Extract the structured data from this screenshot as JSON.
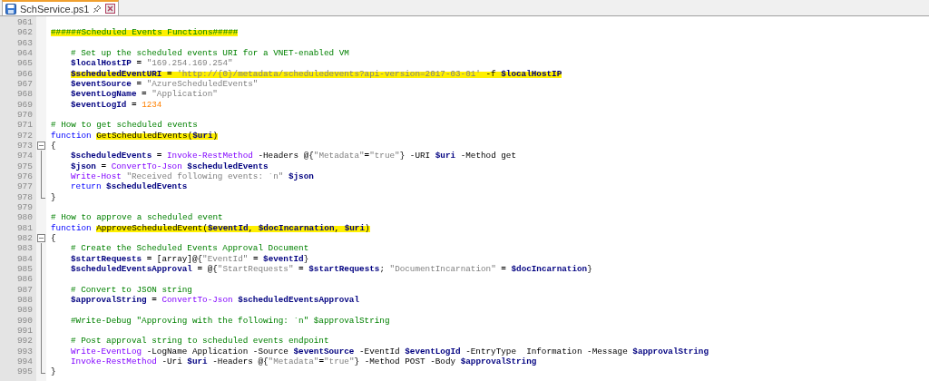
{
  "tab": {
    "title": "SchService.ps1",
    "selected": true
  },
  "lines": [
    {
      "number": "961",
      "kind": "code"
    },
    {
      "number": "962",
      "kind": "code",
      "indented": false,
      "tokens": [
        {
          "kind": "comment",
          "text": "######Scheduled Events Functions#####",
          "highlighted": true
        }
      ]
    },
    {
      "number": "963",
      "kind": "code"
    },
    {
      "number": "964",
      "kind": "code",
      "indented": true,
      "tokens": [
        {
          "kind": "comment",
          "text": "# Set up the scheduled events URI for a VNET-enabled VM",
          "highlighted": false
        }
      ]
    },
    {
      "number": "965",
      "kind": "code",
      "indented": true,
      "tokens": [
        {
          "kind": "variable",
          "text": "$localHostIP",
          "highlighted": false
        },
        {
          "kind": "operator",
          "text": " = ",
          "highlighted": false
        },
        {
          "kind": "string",
          "text": "\"169.254.169.254\"",
          "highlighted": false
        }
      ]
    },
    {
      "number": "966",
      "kind": "code",
      "indented": true,
      "tokens": [
        {
          "kind": "variable",
          "text": "$scheduledEventURI",
          "highlighted": true
        },
        {
          "kind": "operator",
          "text": " = ",
          "highlighted": true
        },
        {
          "kind": "string",
          "text": "'http://{0}/metadata/scheduledevents?api-version=2017-03-01'",
          "highlighted": true
        },
        {
          "kind": "plain",
          "text": " -f ",
          "highlighted": true
        },
        {
          "kind": "variable",
          "text": "$localHostIP",
          "highlighted": true
        }
      ]
    },
    {
      "number": "967",
      "kind": "code",
      "indented": true,
      "tokens": [
        {
          "kind": "variable",
          "text": "$eventSource",
          "highlighted": false
        },
        {
          "kind": "operator",
          "text": " = ",
          "highlighted": false
        },
        {
          "kind": "string",
          "text": "\"AzureScheduledEvents\"",
          "highlighted": false
        }
      ]
    },
    {
      "number": "968",
      "kind": "code",
      "indented": true,
      "tokens": [
        {
          "kind": "variable",
          "text": "$eventLogName",
          "highlighted": false
        },
        {
          "kind": "operator",
          "text": " = ",
          "highlighted": false
        },
        {
          "kind": "string",
          "text": "\"Application\"",
          "highlighted": false
        }
      ]
    },
    {
      "number": "969",
      "kind": "code",
      "indented": true,
      "tokens": [
        {
          "kind": "variable",
          "text": "$eventLogId",
          "highlighted": false
        },
        {
          "kind": "operator",
          "text": " = ",
          "highlighted": false
        },
        {
          "kind": "number",
          "text": "1234",
          "highlighted": false
        }
      ]
    },
    {
      "number": "970",
      "kind": "code"
    },
    {
      "number": "971",
      "kind": "code",
      "indented": false,
      "tokens": [
        {
          "kind": "comment",
          "text": "# How to get scheduled events",
          "highlighted": false
        }
      ]
    },
    {
      "number": "972",
      "kind": "code",
      "indented": false,
      "tokens": [
        {
          "kind": "keyword",
          "text": "function ",
          "highlighted": false
        },
        {
          "kind": "plain",
          "text": "GetScheduledEvents(",
          "highlighted": true
        },
        {
          "kind": "variable",
          "text": "$uri",
          "highlighted": true
        },
        {
          "kind": "plain",
          "text": ")",
          "highlighted": true
        }
      ]
    },
    {
      "number": "973",
      "kind": "fold_start",
      "indented": false,
      "tokens": [
        {
          "kind": "plain",
          "text": "{",
          "highlighted": false
        }
      ]
    },
    {
      "number": "974",
      "kind": "fold_body",
      "indented": true,
      "tokens": [
        {
          "kind": "variable",
          "text": "$scheduledEvents",
          "highlighted": false
        },
        {
          "kind": "operator",
          "text": " = ",
          "highlighted": false
        },
        {
          "kind": "cmdlet",
          "text": "Invoke-RestMethod",
          "highlighted": false
        },
        {
          "kind": "plain",
          "text": " -Headers @{",
          "highlighted": false
        },
        {
          "kind": "string",
          "text": "\"Metadata\"",
          "highlighted": false
        },
        {
          "kind": "operator",
          "text": "=",
          "highlighted": false
        },
        {
          "kind": "string",
          "text": "\"true\"",
          "highlighted": false
        },
        {
          "kind": "plain",
          "text": "} -URI ",
          "highlighted": false
        },
        {
          "kind": "variable",
          "text": "$uri",
          "highlighted": false
        },
        {
          "kind": "plain",
          "text": " -Method get",
          "highlighted": false
        }
      ]
    },
    {
      "number": "975",
      "kind": "fold_body",
      "indented": true,
      "tokens": [
        {
          "kind": "variable",
          "text": "$json",
          "highlighted": false
        },
        {
          "kind": "operator",
          "text": " = ",
          "highlighted": false
        },
        {
          "kind": "cmdlet",
          "text": "ConvertTo-Json ",
          "highlighted": false
        },
        {
          "kind": "variable",
          "text": "$scheduledEvents",
          "highlighted": false
        }
      ]
    },
    {
      "number": "976",
      "kind": "fold_body",
      "indented": true,
      "tokens": [
        {
          "kind": "cmdlet",
          "text": "Write-Host ",
          "highlighted": false
        },
        {
          "kind": "string",
          "text": "\"Received following events: `n\" ",
          "highlighted": false
        },
        {
          "kind": "variable",
          "text": "$json",
          "highlighted": false
        }
      ]
    },
    {
      "number": "977",
      "kind": "fold_body",
      "indented": true,
      "tokens": [
        {
          "kind": "keyword",
          "text": "return ",
          "highlighted": false
        },
        {
          "kind": "variable",
          "text": "$scheduledEvents",
          "highlighted": false
        }
      ]
    },
    {
      "number": "978",
      "kind": "fold_end",
      "indented": false,
      "tokens": [
        {
          "kind": "plain",
          "text": "}",
          "highlighted": false
        }
      ]
    },
    {
      "number": "979",
      "kind": "code"
    },
    {
      "number": "980",
      "kind": "code",
      "indented": false,
      "tokens": [
        {
          "kind": "comment",
          "text": "# How to approve a scheduled event",
          "highlighted": false
        }
      ]
    },
    {
      "number": "981",
      "kind": "code",
      "indented": false,
      "tokens": [
        {
          "kind": "keyword",
          "text": "function ",
          "highlighted": false
        },
        {
          "kind": "plain",
          "text": "ApproveScheduledEvent(",
          "highlighted": true
        },
        {
          "kind": "variable",
          "text": "$eventId",
          "highlighted": true
        },
        {
          "kind": "plain",
          "text": ", ",
          "highlighted": true
        },
        {
          "kind": "variable",
          "text": "$docIncarnation",
          "highlighted": true
        },
        {
          "kind": "plain",
          "text": ", ",
          "highlighted": true
        },
        {
          "kind": "variable",
          "text": "$uri",
          "highlighted": true
        },
        {
          "kind": "plain",
          "text": ")",
          "highlighted": true
        }
      ]
    },
    {
      "number": "982",
      "kind": "fold_start",
      "indented": false,
      "tokens": [
        {
          "kind": "plain",
          "text": "{",
          "highlighted": false
        }
      ]
    },
    {
      "number": "983",
      "kind": "fold_body",
      "indented": true,
      "tokens": [
        {
          "kind": "comment",
          "text": "# Create the Scheduled Events Approval Document",
          "highlighted": false
        }
      ]
    },
    {
      "number": "984",
      "kind": "fold_body",
      "indented": true,
      "tokens": [
        {
          "kind": "variable",
          "text": "$startRequests",
          "highlighted": false
        },
        {
          "kind": "operator",
          "text": " = ",
          "highlighted": false
        },
        {
          "kind": "plain",
          "text": "[array]@{",
          "highlighted": false
        },
        {
          "kind": "string",
          "text": "\"EventId\"",
          "highlighted": false
        },
        {
          "kind": "operator",
          "text": " = ",
          "highlighted": false
        },
        {
          "kind": "variable",
          "text": "$eventId",
          "highlighted": false
        },
        {
          "kind": "plain",
          "text": "}",
          "highlighted": false
        }
      ]
    },
    {
      "number": "985",
      "kind": "fold_body",
      "indented": true,
      "tokens": [
        {
          "kind": "variable",
          "text": "$scheduledEventsApproval",
          "highlighted": false
        },
        {
          "kind": "operator",
          "text": " = ",
          "highlighted": false
        },
        {
          "kind": "plain",
          "text": "@{",
          "highlighted": false
        },
        {
          "kind": "string",
          "text": "\"StartRequests\"",
          "highlighted": false
        },
        {
          "kind": "operator",
          "text": " = ",
          "highlighted": false
        },
        {
          "kind": "variable",
          "text": "$startRequests",
          "highlighted": false
        },
        {
          "kind": "plain",
          "text": "; ",
          "highlighted": false
        },
        {
          "kind": "string",
          "text": "\"DocumentIncarnation\"",
          "highlighted": false
        },
        {
          "kind": "operator",
          "text": " = ",
          "highlighted": false
        },
        {
          "kind": "variable",
          "text": "$docIncarnation",
          "highlighted": false
        },
        {
          "kind": "plain",
          "text": "}",
          "highlighted": false
        }
      ]
    },
    {
      "number": "986",
      "kind": "fold_body"
    },
    {
      "number": "987",
      "kind": "fold_body",
      "indented": true,
      "tokens": [
        {
          "kind": "comment",
          "text": "# Convert to JSON string",
          "highlighted": false
        }
      ]
    },
    {
      "number": "988",
      "kind": "fold_body",
      "indented": true,
      "tokens": [
        {
          "kind": "variable",
          "text": "$approvalString",
          "highlighted": false
        },
        {
          "kind": "operator",
          "text": " = ",
          "highlighted": false
        },
        {
          "kind": "cmdlet",
          "text": "ConvertTo-Json ",
          "highlighted": false
        },
        {
          "kind": "variable",
          "text": "$scheduledEventsApproval",
          "highlighted": false
        }
      ]
    },
    {
      "number": "989",
      "kind": "fold_body"
    },
    {
      "number": "990",
      "kind": "fold_body",
      "indented": true,
      "tokens": [
        {
          "kind": "comment",
          "text": "#Write-Debug \"Approving with the following: `n\" $approvalString",
          "highlighted": false
        }
      ]
    },
    {
      "number": "991",
      "kind": "fold_body"
    },
    {
      "number": "992",
      "kind": "fold_body",
      "indented": true,
      "tokens": [
        {
          "kind": "comment",
          "text": "# Post approval string to scheduled events endpoint",
          "highlighted": false
        }
      ]
    },
    {
      "number": "993",
      "kind": "fold_body",
      "indented": true,
      "tokens": [
        {
          "kind": "cmdlet",
          "text": "Write-EventLog",
          "highlighted": false
        },
        {
          "kind": "plain",
          "text": " -LogName Application -Source ",
          "highlighted": false
        },
        {
          "kind": "variable",
          "text": "$eventSource",
          "highlighted": false
        },
        {
          "kind": "plain",
          "text": " -EventId ",
          "highlighted": false
        },
        {
          "kind": "variable",
          "text": "$eventLogId",
          "highlighted": false
        },
        {
          "kind": "plain",
          "text": " -EntryType  Information -Message ",
          "highlighted": false
        },
        {
          "kind": "variable",
          "text": "$approvalString",
          "highlighted": false
        }
      ]
    },
    {
      "number": "994",
      "kind": "fold_body",
      "indented": true,
      "tokens": [
        {
          "kind": "cmdlet",
          "text": "Invoke-RestMethod",
          "highlighted": false
        },
        {
          "kind": "plain",
          "text": " -Uri ",
          "highlighted": false
        },
        {
          "kind": "variable",
          "text": "$uri",
          "highlighted": false
        },
        {
          "kind": "plain",
          "text": " -Headers @{",
          "highlighted": false
        },
        {
          "kind": "string",
          "text": "\"Metadata\"",
          "highlighted": false
        },
        {
          "kind": "operator",
          "text": "=",
          "highlighted": false
        },
        {
          "kind": "string",
          "text": "\"true\"",
          "highlighted": false
        },
        {
          "kind": "plain",
          "text": "} -Method POST -Body ",
          "highlighted": false
        },
        {
          "kind": "variable",
          "text": "$approvalString",
          "highlighted": false
        }
      ]
    },
    {
      "number": "995",
      "kind": "fold_end",
      "indented": false,
      "tokens": [
        {
          "kind": "plain",
          "text": "}",
          "highlighted": false
        }
      ]
    }
  ]
}
